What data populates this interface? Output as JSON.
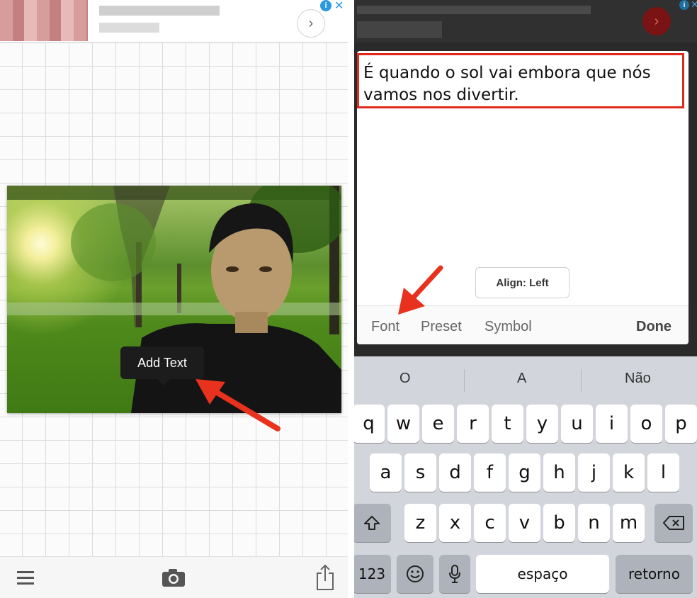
{
  "left": {
    "ad": {
      "chevron": "›",
      "info": "i",
      "close": "✕"
    },
    "tooltip": "Add Text",
    "bottom": {
      "menu_icon": "hamburger-menu-icon",
      "camera_icon": "camera-icon",
      "share_icon": "share-icon"
    }
  },
  "right": {
    "ad": {
      "chevron": "›",
      "info": "i",
      "close": "✕"
    },
    "text_value": "É quando o sol vai embora que nós vamos nos divertir.",
    "align_button": "Align: Left",
    "tabs": {
      "font": "Font",
      "preset": "Preset",
      "symbol": "Symbol",
      "done": "Done"
    },
    "suggestions": [
      "O",
      "A",
      "Não"
    ],
    "keyboard": {
      "row1": [
        "q",
        "w",
        "e",
        "r",
        "t",
        "y",
        "u",
        "i",
        "o",
        "p"
      ],
      "row2": [
        "a",
        "s",
        "d",
        "f",
        "g",
        "h",
        "j",
        "k",
        "l"
      ],
      "row3": [
        "z",
        "x",
        "c",
        "v",
        "b",
        "n",
        "m"
      ],
      "numbers": "123",
      "space": "espaço",
      "return": "retorno"
    }
  },
  "colors": {
    "highlight": "#e0291d",
    "arrow": "#e8321e",
    "keyboard_bg": "#d2d5db"
  }
}
